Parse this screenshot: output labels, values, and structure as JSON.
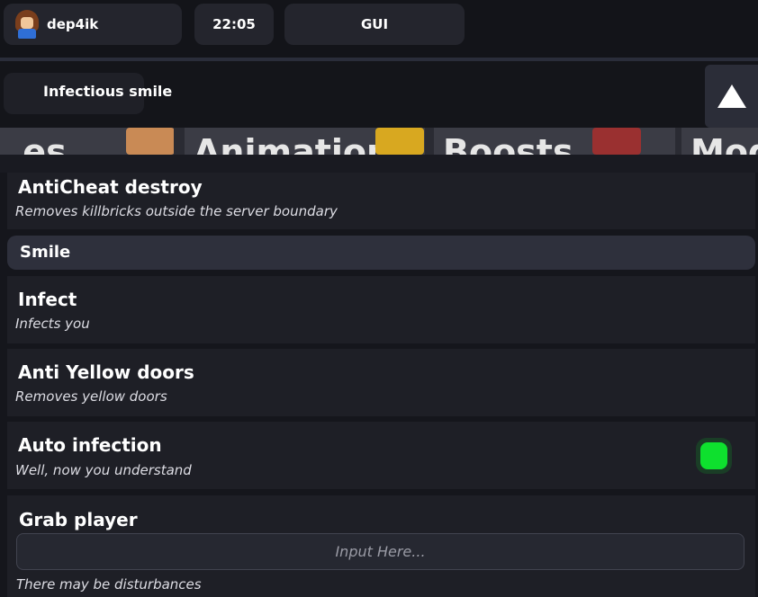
{
  "topbar": {
    "username": "dep4ik",
    "time": "22:05",
    "gui_label": "GUI"
  },
  "header": {
    "title": "Infectious smile"
  },
  "tabs": [
    {
      "label": "...es"
    },
    {
      "label": "Animation"
    },
    {
      "label": "Boosts"
    },
    {
      "label": "Modi"
    }
  ],
  "options": [
    {
      "title": "AntiCheat destroy",
      "description": "Removes killbricks outside the server boundary"
    },
    {
      "title": "Infect",
      "description": "Infects you"
    },
    {
      "title": "Anti Yellow doors",
      "description": "Removes yellow doors"
    },
    {
      "title": "Auto infection",
      "description": "Well, now you understand",
      "toggle_on": true,
      "toggle_color": "#0ee02e"
    },
    {
      "title": "Grab player",
      "input_placeholder": "Input Here...",
      "description": "There may be disturbances"
    }
  ],
  "section": {
    "label": "Smile"
  }
}
